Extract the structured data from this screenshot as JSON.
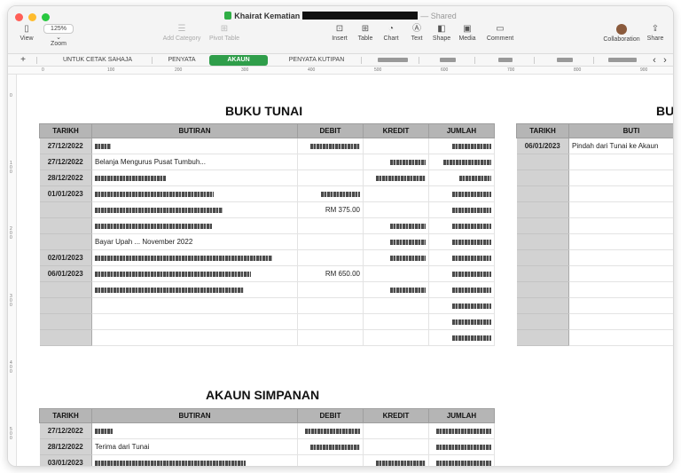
{
  "window": {
    "title": "Khairat Kematian",
    "shared_label": "— Shared"
  },
  "toolbar": {
    "view": "View",
    "zoom_value": "125%",
    "zoom": "Zoom",
    "add_category": "Add Category",
    "pivot_table": "Pivot Table",
    "insert": "Insert",
    "table": "Table",
    "chart": "Chart",
    "text": "Text",
    "shape": "Shape",
    "media": "Media",
    "comment": "Comment",
    "collaboration": "Collaboration",
    "share": "Share"
  },
  "tabs": {
    "add": "+",
    "items": [
      "UNTUK CETAK SAHAJA",
      "PENYATA",
      "AKAUN",
      "PENYATA KUTIPAN"
    ],
    "active": "AKAUN",
    "scroll_left": "‹",
    "scroll_right": "›"
  },
  "ruler": {
    "top": [
      "0",
      "100",
      "200",
      "300",
      "400",
      "500",
      "600",
      "700",
      "800",
      "900"
    ],
    "left": [
      "0",
      "1\n0\n0",
      "2\n0\n0",
      "3\n0\n0",
      "4\n0\n0",
      "5\n0\n0"
    ]
  },
  "buku_tunai": {
    "title": "BUKU TUNAI",
    "headers": [
      "TARIKH",
      "BUTIRAN",
      "DEBIT",
      "KREDIT",
      "JUMLAH"
    ],
    "rows": [
      [
        "27/12/2022",
        "",
        "",
        "",
        ""
      ],
      [
        "27/12/2022",
        "Belanja Mengurus Pusat Tumbuh...",
        "",
        "",
        ""
      ],
      [
        "28/12/2022",
        "",
        "",
        "",
        ""
      ],
      [
        "01/01/2023",
        "",
        "",
        "",
        ""
      ],
      [
        "",
        "",
        "RM 375.00",
        "",
        ""
      ],
      [
        "",
        "",
        "",
        "",
        ""
      ],
      [
        "",
        "Bayar Upah ... November 2022",
        "",
        "",
        ""
      ],
      [
        "02/01/2023",
        "",
        "",
        "",
        ""
      ],
      [
        "06/01/2023",
        "",
        "RM 650.00",
        "",
        ""
      ],
      [
        "",
        "",
        "",
        "",
        ""
      ],
      [
        "",
        "",
        "",
        "",
        ""
      ],
      [
        "",
        "",
        "",
        "",
        ""
      ],
      [
        "",
        "",
        "",
        "",
        ""
      ]
    ]
  },
  "buku_tunai_2": {
    "title": "BUK",
    "headers": [
      "TARIKH",
      "BUTI"
    ],
    "rows": [
      [
        "06/01/2023",
        "Pindah dari Tunai ke Akaun"
      ]
    ]
  },
  "akaun_simpanan": {
    "title": "AKAUN SIMPANAN",
    "headers": [
      "TARIKH",
      "BUTIRAN",
      "DEBIT",
      "KREDIT",
      "JUMLAH"
    ],
    "rows": [
      [
        "27/12/2022",
        "",
        "",
        "",
        ""
      ],
      [
        "28/12/2022",
        "Terima dari Tunai",
        "",
        "",
        ""
      ],
      [
        "03/01/2023",
        "",
        "",
        "",
        ""
      ]
    ]
  },
  "colors": {
    "accent": "#2f9e4a",
    "header": "#b5b5b5",
    "date_cell": "#d2d2d2"
  }
}
